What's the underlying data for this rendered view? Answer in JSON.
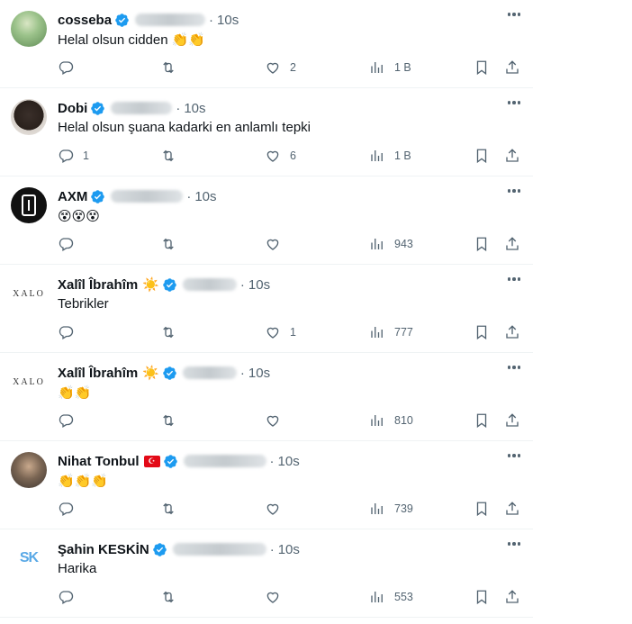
{
  "tweets": [
    {
      "name": "cosseba",
      "sun": "",
      "flag": "",
      "time": "10s",
      "text": "Helal olsun cidden 👏👏",
      "replies": "",
      "retweets": "",
      "likes": "2",
      "views": "1 B",
      "avatar": "photo1"
    },
    {
      "name": "Dobi",
      "sun": "",
      "flag": "",
      "time": "10s",
      "text": "Helal olsun şuana kadarki en anlamlı tepki",
      "replies": "1",
      "retweets": "",
      "likes": "6",
      "views": "1 B",
      "avatar": "photo2"
    },
    {
      "name": "AXM",
      "sun": "",
      "flag": "",
      "time": "10s",
      "text": "😵😵😵",
      "replies": "",
      "retweets": "",
      "likes": "",
      "views": "943",
      "avatar": "axm"
    },
    {
      "name": "Xalîl Îbrahîm",
      "sun": "☀️",
      "flag": "",
      "time": "10s",
      "text": "Tebrikler",
      "replies": "",
      "retweets": "",
      "likes": "1",
      "views": "777",
      "avatar": "xalo",
      "avatar_text": "XALO"
    },
    {
      "name": "Xalîl Îbrahîm",
      "sun": "☀️",
      "flag": "",
      "time": "10s",
      "text": "👏👏",
      "replies": "",
      "retweets": "",
      "likes": "",
      "views": "810",
      "avatar": "xalo",
      "avatar_text": "XALO"
    },
    {
      "name": "Nihat Tonbul",
      "sun": "",
      "flag": "☪",
      "time": "10s",
      "text": "👏👏👏",
      "replies": "",
      "retweets": "",
      "likes": "",
      "views": "739",
      "avatar": "photo3"
    },
    {
      "name": "Şahin KESKİN",
      "sun": "",
      "flag": "",
      "time": "10s",
      "text": "Harika",
      "replies": "",
      "retweets": "",
      "likes": "",
      "views": "553",
      "avatar": "sk",
      "avatar_text": "SK"
    }
  ],
  "icons": {
    "verified": "verified-badge-icon",
    "reply": "reply-icon",
    "retweet": "retweet-icon",
    "like": "heart-icon",
    "views": "views-icon",
    "bookmark": "bookmark-icon",
    "share": "share-icon",
    "more": "more-icon"
  },
  "colors": {
    "verified": "#1d9bf0",
    "muted": "#536471",
    "text": "#0f1419",
    "divider": "#eff3f4",
    "flag": "#e30a17"
  }
}
